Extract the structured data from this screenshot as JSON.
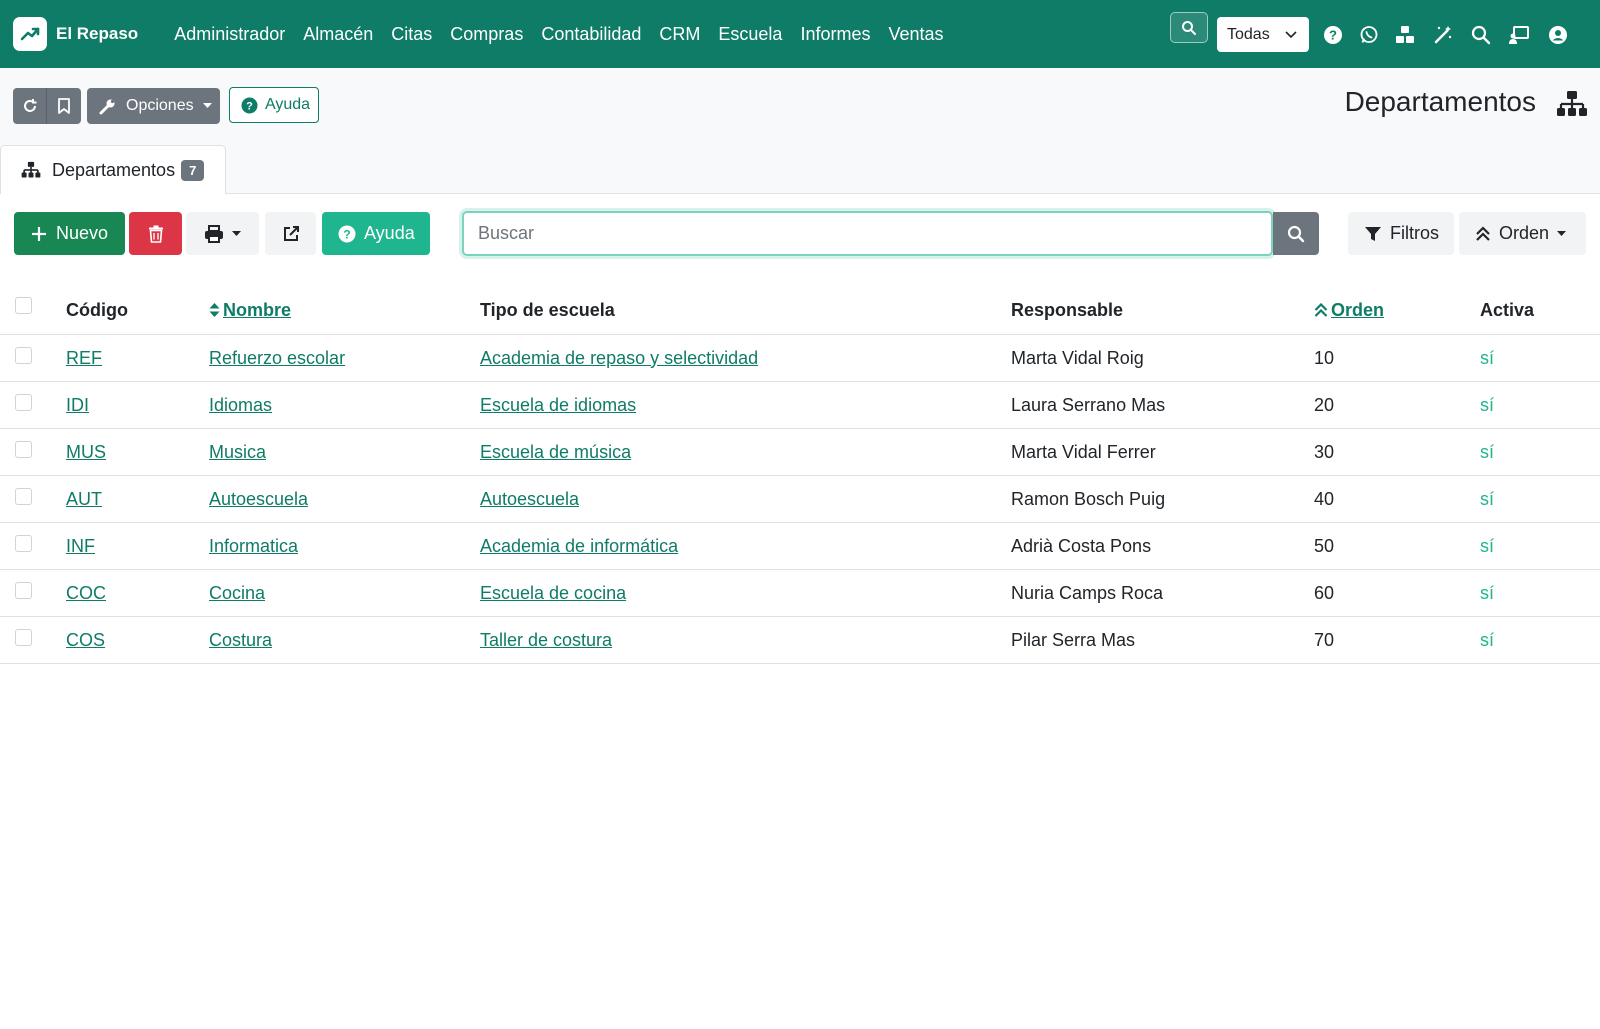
{
  "app": {
    "brand": "El Repaso",
    "menu": [
      "Administrador",
      "Almacén",
      "Citas",
      "Compras",
      "Contabilidad",
      "CRM",
      "Escuela",
      "Informes",
      "Ventas"
    ],
    "company_select": "Todas"
  },
  "header": {
    "opciones_label": "Opciones",
    "ayuda_label": "Ayuda",
    "page_title": "Departamentos"
  },
  "tab": {
    "label": "Departamentos",
    "count": "7"
  },
  "toolbar": {
    "nuevo_label": "Nuevo",
    "ayuda_label": "Ayuda",
    "search_placeholder": "Buscar",
    "filtros_label": "Filtros",
    "orden_label": "Orden"
  },
  "table": {
    "columns": {
      "codigo": "Código",
      "nombre": "Nombre",
      "tipo": "Tipo de escuela",
      "responsable": "Responsable",
      "orden": "Orden",
      "activa": "Activa"
    },
    "rows": [
      {
        "codigo": "REF",
        "nombre": "Refuerzo escolar",
        "tipo": "Academia de repaso y selectividad",
        "responsable": "Marta Vidal Roig",
        "orden": "10",
        "activa": "sí"
      },
      {
        "codigo": "IDI",
        "nombre": "Idiomas",
        "tipo": "Escuela de idiomas",
        "responsable": "Laura Serrano Mas",
        "orden": "20",
        "activa": "sí"
      },
      {
        "codigo": "MUS",
        "nombre": "Musica",
        "tipo": "Escuela de música",
        "responsable": "Marta Vidal Ferrer",
        "orden": "30",
        "activa": "sí"
      },
      {
        "codigo": "AUT",
        "nombre": "Autoescuela",
        "tipo": "Autoescuela",
        "responsable": "Ramon Bosch Puig",
        "orden": "40",
        "activa": "sí"
      },
      {
        "codigo": "INF",
        "nombre": "Informatica",
        "tipo": "Academia de informática",
        "responsable": "Adrià Costa Pons",
        "orden": "50",
        "activa": "sí"
      },
      {
        "codigo": "COC",
        "nombre": "Cocina",
        "tipo": "Escuela de cocina",
        "responsable": "Nuria Camps Roca",
        "orden": "60",
        "activa": "sí"
      },
      {
        "codigo": "COS",
        "nombre": "Costura",
        "tipo": "Taller de costura",
        "responsable": "Pilar Serra Mas",
        "orden": "70",
        "activa": "sí"
      }
    ]
  },
  "colors": {
    "navbar": "#0e7c66",
    "primary_link": "#0e7c66",
    "success": "#198754",
    "danger": "#dc3545",
    "info": "#1fb58f",
    "secondary": "#6c757d"
  }
}
